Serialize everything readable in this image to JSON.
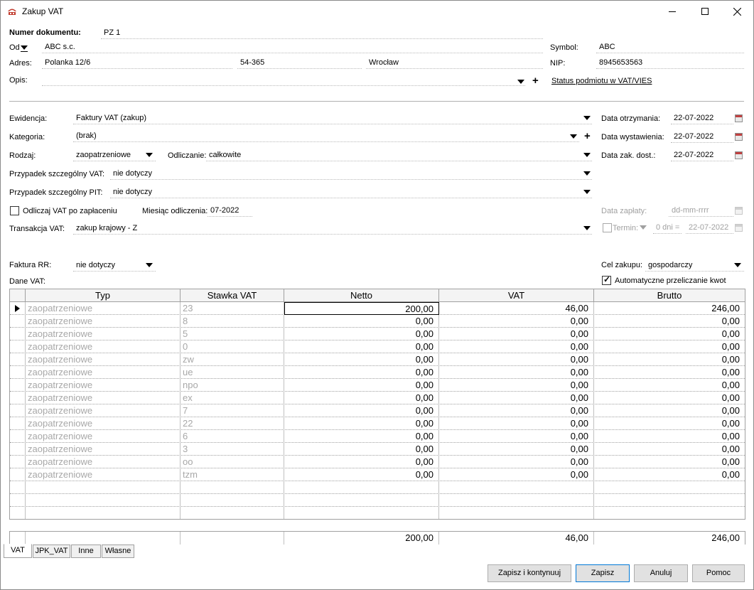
{
  "window": {
    "title": "Zakup VAT"
  },
  "header": {
    "numer_label": "Numer dokumentu:",
    "numer_value": "PZ 1",
    "od_label": "Od",
    "od_value": "ABC s.c.",
    "adres_label": "Adres:",
    "adres_street": "Polanka  12/6",
    "adres_zip": "54-365",
    "adres_city": "Wrocław",
    "opis_label": "Opis:",
    "opis_value": "",
    "symbol_label": "Symbol:",
    "symbol_value": "ABC",
    "nip_label": "NIP:",
    "nip_value": "8945653563",
    "status_link": "Status podmiotu w VAT/VIES"
  },
  "form": {
    "ewidencja_label": "Ewidencja:",
    "ewidencja_value": "Faktury VAT (zakup)",
    "kategoria_label": "Kategoria:",
    "kategoria_value": "(brak)",
    "rodzaj_label": "Rodzaj:",
    "rodzaj_value": "zaopatrzeniowe",
    "odliczanie_label": "Odliczanie:",
    "odliczanie_value": "całkowite",
    "psvat_label": "Przypadek szczególny VAT:",
    "psvat_value": "nie dotyczy",
    "pspit_label": "Przypadek szczególny PIT:",
    "pspit_value": "nie dotyczy",
    "odliczaj_label": "Odliczaj VAT po zapłaceniu",
    "miesiac_label": "Miesiąc odliczenia:",
    "miesiac_value": "07-2022",
    "transakcja_label": "Transakcja VAT:",
    "transakcja_value": "zakup krajowy - Z",
    "faktura_rr_label": "Faktura RR:",
    "faktura_rr_value": "nie dotyczy",
    "dane_vat_label": "Dane VAT:"
  },
  "dates": {
    "otrzymania_label": "Data otrzymania:",
    "otrzymania_value": "22-07-2022",
    "wystawienia_label": "Data wystawienia:",
    "wystawienia_value": "22-07-2022",
    "zak_dost_label": "Data zak. dost.:",
    "zak_dost_value": "22-07-2022",
    "zaplaty_label": "Data zapłaty:",
    "zaplaty_value": "dd-mm-rrrr",
    "termin_label": "Termin:",
    "termin_days": "0 dni =",
    "termin_date": "22-07-2022",
    "cel_label": "Cel zakupu:",
    "cel_value": "gospodarczy",
    "auto_label": "Automatyczne przeliczanie kwot"
  },
  "grid": {
    "headers": [
      "Typ",
      "Stawka VAT",
      "Netto",
      "VAT",
      "Brutto"
    ],
    "rows": [
      {
        "typ": "zaopatrzeniowe",
        "stawka": "23",
        "netto": "200,00",
        "vat": "46,00",
        "brutto": "246,00"
      },
      {
        "typ": "zaopatrzeniowe",
        "stawka": "8",
        "netto": "0,00",
        "vat": "0,00",
        "brutto": "0,00"
      },
      {
        "typ": "zaopatrzeniowe",
        "stawka": "5",
        "netto": "0,00",
        "vat": "0,00",
        "brutto": "0,00"
      },
      {
        "typ": "zaopatrzeniowe",
        "stawka": "0",
        "netto": "0,00",
        "vat": "0,00",
        "brutto": "0,00"
      },
      {
        "typ": "zaopatrzeniowe",
        "stawka": "zw",
        "netto": "0,00",
        "vat": "0,00",
        "brutto": "0,00"
      },
      {
        "typ": "zaopatrzeniowe",
        "stawka": "ue",
        "netto": "0,00",
        "vat": "0,00",
        "brutto": "0,00"
      },
      {
        "typ": "zaopatrzeniowe",
        "stawka": "npo",
        "netto": "0,00",
        "vat": "0,00",
        "brutto": "0,00"
      },
      {
        "typ": "zaopatrzeniowe",
        "stawka": "ex",
        "netto": "0,00",
        "vat": "0,00",
        "brutto": "0,00"
      },
      {
        "typ": "zaopatrzeniowe",
        "stawka": "7",
        "netto": "0,00",
        "vat": "0,00",
        "brutto": "0,00"
      },
      {
        "typ": "zaopatrzeniowe",
        "stawka": "22",
        "netto": "0,00",
        "vat": "0,00",
        "brutto": "0,00"
      },
      {
        "typ": "zaopatrzeniowe",
        "stawka": "6",
        "netto": "0,00",
        "vat": "0,00",
        "brutto": "0,00"
      },
      {
        "typ": "zaopatrzeniowe",
        "stawka": "3",
        "netto": "0,00",
        "vat": "0,00",
        "brutto": "0,00"
      },
      {
        "typ": "zaopatrzeniowe",
        "stawka": "oo",
        "netto": "0,00",
        "vat": "0,00",
        "brutto": "0,00"
      },
      {
        "typ": "zaopatrzeniowe",
        "stawka": "tzm",
        "netto": "0,00",
        "vat": "0,00",
        "brutto": "0,00"
      }
    ],
    "totals": {
      "netto": "200,00",
      "vat": "46,00",
      "brutto": "246,00"
    }
  },
  "tabs": [
    "VAT",
    "JPK_VAT",
    "Inne",
    "Własne"
  ],
  "buttons": {
    "zapisz_kont": "Zapisz i kontynuuj",
    "zapisz": "Zapisz",
    "anuluj": "Anuluj",
    "pomoc": "Pomoc"
  },
  "colors": {
    "accent": "#0078d7",
    "disabled_text": "#a0a0a0",
    "icon_red": "#c0392b"
  }
}
